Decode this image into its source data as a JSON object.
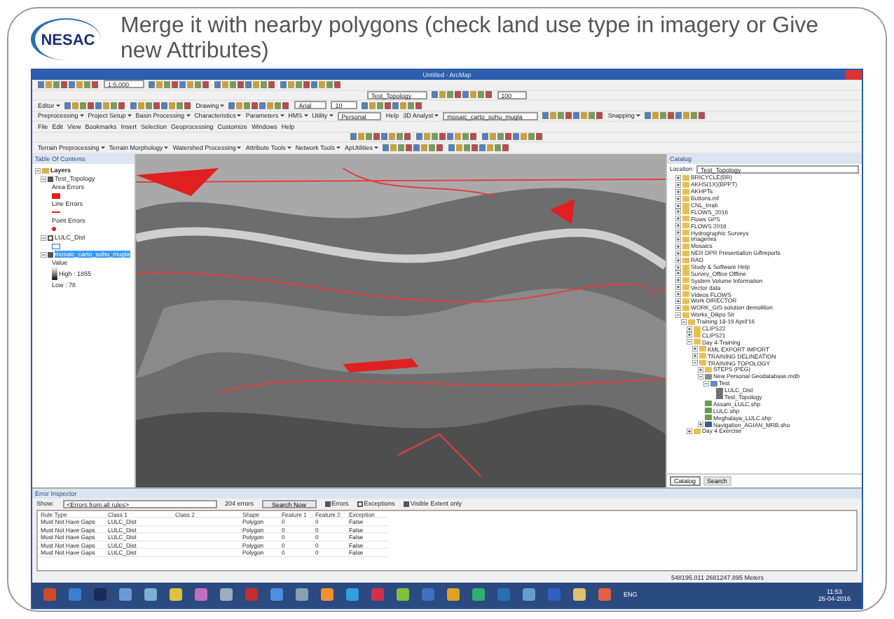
{
  "slide": {
    "logo": "NESAC",
    "title": "Merge it with nearby polygons (check land use type in imagery or Give new Attributes)"
  },
  "window": {
    "title": "Untitled - ArcMap"
  },
  "toolbars": [
    [
      {
        "kind": "icons"
      },
      {
        "kind": "combo",
        "text": "1:5,000"
      },
      {
        "kind": "icons"
      },
      {
        "kind": "icons"
      },
      {
        "kind": "icons"
      }
    ],
    [
      {
        "kind": "combo",
        "text": "Test_Topology"
      },
      {
        "kind": "icons"
      },
      {
        "kind": "combo",
        "text": "100"
      }
    ],
    [
      {
        "kind": "menu",
        "text": "Editor"
      },
      {
        "kind": "icons"
      },
      {
        "kind": "icons"
      },
      {
        "kind": "menu",
        "text": "Drawing"
      },
      {
        "kind": "icons"
      },
      {
        "kind": "combo",
        "text": "Arial"
      },
      {
        "kind": "combo",
        "text": "10"
      },
      {
        "kind": "icons"
      }
    ],
    [
      {
        "kind": "menu",
        "text": "Preprocessing"
      },
      {
        "kind": "menu",
        "text": "Project Setup"
      },
      {
        "kind": "menu",
        "text": "Basin Processing"
      },
      {
        "kind": "menu",
        "text": "Characteristics"
      },
      {
        "kind": "menu",
        "text": "Parameters"
      },
      {
        "kind": "menu",
        "text": "HMS"
      },
      {
        "kind": "menu",
        "text": "Utility"
      },
      {
        "kind": "combo",
        "text": "Personal"
      },
      {
        "kind": "button",
        "text": "Help"
      },
      {
        "kind": "menu",
        "text": "3D Analyst"
      },
      {
        "kind": "combo",
        "text": "mosaic_carto_sohu_mugla"
      },
      {
        "kind": "icons"
      },
      {
        "kind": "menu",
        "text": "Snapping"
      },
      {
        "kind": "icons"
      }
    ],
    [
      {
        "kind": "button",
        "text": "File"
      },
      {
        "kind": "button",
        "text": "Edit"
      },
      {
        "kind": "button",
        "text": "View"
      },
      {
        "kind": "button",
        "text": "Bookmarks"
      },
      {
        "kind": "button",
        "text": "Insert"
      },
      {
        "kind": "button",
        "text": "Selection"
      },
      {
        "kind": "button",
        "text": "Geoprocessing"
      },
      {
        "kind": "button",
        "text": "Customize"
      },
      {
        "kind": "button",
        "text": "Windows"
      },
      {
        "kind": "button",
        "text": "Help"
      }
    ],
    [
      {
        "kind": "icons"
      },
      {
        "kind": "icons"
      },
      {
        "kind": "icons"
      }
    ],
    [
      {
        "kind": "menu",
        "text": "Terrain Preprocessing"
      },
      {
        "kind": "menu",
        "text": "Terrain Morphology"
      },
      {
        "kind": "menu",
        "text": "Watershed Processing"
      },
      {
        "kind": "menu",
        "text": "Attribute Tools"
      },
      {
        "kind": "menu",
        "text": "Network Tools"
      },
      {
        "kind": "menu",
        "text": "ApUtilities"
      },
      {
        "kind": "icons"
      },
      {
        "kind": "icons"
      }
    ]
  ],
  "toc": {
    "title": "Table Of Contents",
    "layers": [
      {
        "kind": "group",
        "label": "Layers",
        "expanded": true,
        "children": [
          {
            "kind": "layer",
            "label": "Test_Topology",
            "checked": true,
            "selected": false,
            "expanded": true,
            "children": [
              {
                "kind": "legend",
                "label": "Area Errors"
              },
              {
                "kind": "area-symbol"
              },
              {
                "kind": "legend",
                "label": "Line Errors"
              },
              {
                "kind": "line-symbol"
              },
              {
                "kind": "legend",
                "label": "Point Errors"
              },
              {
                "kind": "point-symbol"
              }
            ]
          },
          {
            "kind": "layer",
            "label": "LULC_Dist",
            "checked": false,
            "selected": false,
            "expanded": true,
            "children": [
              {
                "kind": "fill-symbol"
              }
            ]
          },
          {
            "kind": "layer",
            "label": "mosaic_carto_sohu_mugla",
            "checked": true,
            "selected": true,
            "expanded": true,
            "children": [
              {
                "kind": "legend",
                "label": "Value"
              },
              {
                "kind": "ramp",
                "label": "High : 1855"
              },
              {
                "kind": "legend",
                "label": "Low : 78"
              }
            ]
          }
        ]
      }
    ]
  },
  "catalog": {
    "title": "Catalog",
    "location_label": "Location:",
    "location": "Test_Topology",
    "items": [
      {
        "label": "BRICYCLE(BR)",
        "kind": "folder",
        "expanded": false
      },
      {
        "label": "AKHS(1X)(BPPT)",
        "kind": "folder",
        "expanded": false
      },
      {
        "label": "AKHPTs",
        "kind": "folder",
        "expanded": false
      },
      {
        "label": "Buttons.mf",
        "kind": "folder",
        "expanded": false
      },
      {
        "label": "CNL_Irrab",
        "kind": "folder",
        "expanded": false
      },
      {
        "label": "FLOWS_2016",
        "kind": "folder",
        "expanded": false
      },
      {
        "label": "Flows GPS",
        "kind": "folder",
        "expanded": false
      },
      {
        "label": "FLOWS 2016",
        "kind": "folder",
        "expanded": false
      },
      {
        "label": "Hydrographic Surveys",
        "kind": "folder",
        "expanded": false
      },
      {
        "label": "Imageries",
        "kind": "folder",
        "expanded": false
      },
      {
        "label": "Mosaics",
        "kind": "folder",
        "expanded": false
      },
      {
        "label": "NER DPR Presentation Giflreports",
        "kind": "folder",
        "expanded": false
      },
      {
        "label": "RAD",
        "kind": "folder",
        "expanded": false
      },
      {
        "label": "Study & Software Help",
        "kind": "folder",
        "expanded": false
      },
      {
        "label": "Survey_Office Offline",
        "kind": "folder",
        "expanded": false
      },
      {
        "label": "System Volume Information",
        "kind": "folder",
        "expanded": false
      },
      {
        "label": "Vector data",
        "kind": "folder",
        "expanded": false
      },
      {
        "label": "Videos FLOWS",
        "kind": "folder",
        "expanded": false
      },
      {
        "label": "Work DIRECTOR",
        "kind": "folder",
        "expanded": false
      },
      {
        "label": "WORK_GIS solution demolition",
        "kind": "folder",
        "expanded": false
      },
      {
        "label": "Works_Dikpo Sir",
        "kind": "folder",
        "expanded": true,
        "children": [
          {
            "label": "Training 18-19 April'16",
            "kind": "folder",
            "expanded": true,
            "children": [
              {
                "label": "CLIPS22",
                "kind": "folder",
                "expanded": false
              },
              {
                "label": "CLIPS21",
                "kind": "folder",
                "expanded": false
              },
              {
                "label": "Day 4-Training",
                "kind": "folder",
                "expanded": true,
                "children": [
                  {
                    "label": "KML EXPORT IMPORT",
                    "kind": "folder",
                    "expanded": false
                  },
                  {
                    "label": "TRAINING DELINEATION",
                    "kind": "folder",
                    "expanded": false
                  },
                  {
                    "label": "TRAINING TOPOLOGY",
                    "kind": "folder",
                    "expanded": true,
                    "children": [
                      {
                        "label": "STEPS (PEG)",
                        "kind": "folder",
                        "expanded": false
                      },
                      {
                        "label": "New Personal Geodatabase.mdb",
                        "kind": "database",
                        "expanded": true,
                        "children": [
                          {
                            "label": "Test",
                            "kind": "dataset",
                            "expanded": true,
                            "children": [
                              {
                                "label": "LULC_Dist",
                                "kind": "feature"
                              },
                              {
                                "label": "Test_Topology",
                                "kind": "feature"
                              }
                            ]
                          }
                        ]
                      },
                      {
                        "label": "Assam_LULC.shp",
                        "kind": "shapefile"
                      },
                      {
                        "label": "LULC.shp",
                        "kind": "shapefile"
                      },
                      {
                        "label": "Meghalaya_LULC.shp",
                        "kind": "shapefile"
                      },
                      {
                        "label": "Navigation_AGIAN_MRB.sho",
                        "kind": "map",
                        "expanded": false
                      }
                    ]
                  }
                ]
              },
              {
                "label": "Day 4 Exercise",
                "kind": "folder",
                "expanded": false
              }
            ]
          }
        ]
      }
    ],
    "tabs": [
      {
        "label": "Catalog",
        "selected": true
      },
      {
        "label": "Search",
        "selected": false
      }
    ]
  },
  "error_inspector": {
    "title": "Error Inspector",
    "show_label": "Show:",
    "show_value": "<Errors from all rules>",
    "count": "204 errors",
    "search_button": "Search Now",
    "filters": [
      {
        "label": "Errors",
        "checked": true
      },
      {
        "label": "Exceptions",
        "checked": false
      },
      {
        "label": "Visible Extent only",
        "checked": true
      }
    ],
    "columns": [
      "Rule Type",
      "Class 1",
      "Class 2",
      "Shape",
      "Feature 1",
      "Feature 2",
      "Exception"
    ],
    "rows": [
      [
        "Must Not Have Gaps",
        "LULC_Dist",
        "",
        "Polygon",
        "0",
        "0",
        "False"
      ],
      [
        "Must Not Have Gaps",
        "LULC_Dist",
        "",
        "Polygon",
        "0",
        "0",
        "False"
      ],
      [
        "Must Not Have Gaps",
        "LULC_Dist",
        "",
        "Polygon",
        "0",
        "0",
        "False"
      ],
      [
        "Must Not Have Gaps",
        "LULC_Dist",
        "",
        "Polygon",
        "0",
        "0",
        "False"
      ],
      [
        "Must Not Have Gaps",
        "LULC_Dist",
        "",
        "Polygon",
        "0",
        "0",
        "False"
      ]
    ]
  },
  "status_bar": {
    "coordinates": "548195.011 2681247.895 Meters"
  },
  "taskbar": {
    "apps": [
      {
        "color": "#d04a2a"
      },
      {
        "color": "#3a7fd0"
      },
      {
        "color": "#1a2a5a"
      },
      {
        "color": "#6a9ad8"
      },
      {
        "color": "#7ab0d0"
      },
      {
        "color": "#e0c040"
      },
      {
        "color": "#c070c0"
      },
      {
        "color": "#9ab0c0"
      },
      {
        "color": "#c03030"
      },
      {
        "color": "#4a90e0"
      },
      {
        "color": "#8aa0b0"
      },
      {
        "color": "#f09030"
      },
      {
        "color": "#30a0e0"
      },
      {
        "color": "#d03050"
      },
      {
        "color": "#80c040"
      },
      {
        "color": "#4070c0"
      },
      {
        "color": "#e0a020"
      },
      {
        "color": "#30b070"
      },
      {
        "color": "#2a70b0"
      },
      {
        "color": "#60a0d0"
      },
      {
        "color": "#3060c0"
      },
      {
        "color": "#e0c070"
      },
      {
        "color": "#e06040"
      }
    ],
    "language": "ENG",
    "time": "11:53",
    "date": "26-04-2016"
  }
}
